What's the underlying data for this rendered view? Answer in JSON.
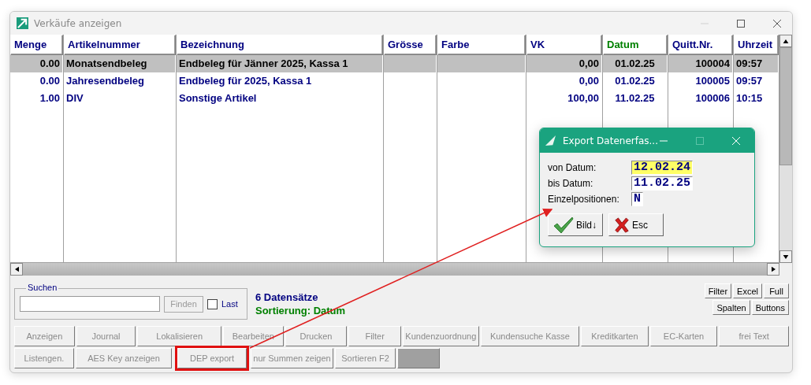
{
  "window": {
    "title": "Verkäufe anzeigen"
  },
  "table": {
    "columns": [
      {
        "label": "Menge",
        "sorted": false
      },
      {
        "label": "Artikelnummer",
        "sorted": false
      },
      {
        "label": "Bezeichnung",
        "sorted": false
      },
      {
        "label": "Grösse",
        "sorted": false
      },
      {
        "label": "Farbe",
        "sorted": false
      },
      {
        "label": "VK",
        "sorted": false
      },
      {
        "label": "Datum",
        "sorted": true
      },
      {
        "label": "Quitt.Nr.",
        "sorted": false
      },
      {
        "label": "Uhrzeit",
        "sorted": false
      }
    ],
    "rows": [
      {
        "selected": true,
        "cells": [
          "0.00",
          "Monatsendbeleg",
          "Endbeleg für Jänner 2025, Kassa 1",
          null,
          null,
          "0,00",
          "01.02.25",
          "100004",
          "09:57"
        ]
      },
      {
        "selected": false,
        "cells": [
          "0.00",
          "Jahresendbeleg",
          "Endbeleg für 2025, Kassa 1",
          null,
          null,
          "0,00",
          "01.02.25",
          "100005",
          "09:57"
        ]
      },
      {
        "selected": false,
        "cells": [
          "1.00",
          "DIV",
          "Sonstige Artikel",
          null,
          null,
          "100,00",
          "11.02.25",
          "100006",
          "10:15"
        ]
      }
    ]
  },
  "search": {
    "label": "Suchen",
    "button": {
      "label": "Finden",
      "disabled": true
    },
    "last": {
      "label": "Last",
      "checked": false
    }
  },
  "status": {
    "count": "6 Datensätze",
    "sorting": "Sortierung: Datum"
  },
  "view_buttons": [
    [
      "Filter",
      "Excel",
      "Full"
    ],
    [
      "Spalten",
      "Buttons"
    ]
  ],
  "action_rows": [
    [
      {
        "kind": "button",
        "label": "Anzeigen",
        "disabled": true
      },
      {
        "kind": "button",
        "label": "Journal",
        "disabled": true
      },
      {
        "kind": "button",
        "label": "Lokalisieren",
        "disabled": true
      },
      {
        "kind": "button",
        "label": "Bearbeiten",
        "disabled": true
      },
      {
        "kind": "button",
        "label": "Drucken",
        "disabled": true
      },
      {
        "kind": "button",
        "label": "Filter",
        "disabled": true
      },
      {
        "kind": "button",
        "label": "Kundenzuordnung",
        "disabled": true
      },
      {
        "kind": "button",
        "label": "Kundensuche Kasse",
        "disabled": true
      },
      {
        "kind": "button",
        "label": "Kreditkarten",
        "disabled": true
      },
      {
        "kind": "button",
        "label": "EC-Karten",
        "disabled": true
      },
      {
        "kind": "button",
        "label": "frei Text",
        "disabled": true
      }
    ],
    [
      {
        "kind": "button",
        "label": "Listengen.",
        "disabled": true
      },
      {
        "kind": "button",
        "label": "AES Key anzeigen",
        "disabled": true
      },
      {
        "kind": "button",
        "label": "DEP export",
        "disabled": true,
        "highlighted": true
      },
      {
        "kind": "button",
        "label": "nur Summen zeigen",
        "disabled": true
      },
      {
        "kind": "button",
        "label": "Sortieren F2",
        "disabled": true
      },
      {
        "kind": "blank"
      }
    ]
  ],
  "dialog": {
    "title": "Export Datenerfas...",
    "fields": [
      {
        "label": "von Datum:",
        "value": "12.02.24",
        "focused": true
      },
      {
        "label": "bis Datum:",
        "value": "11.02.25",
        "focused": false
      },
      {
        "label": "Einzelpositionen:",
        "value": "N",
        "focused": false
      }
    ],
    "buttons": [
      {
        "kind": "ok",
        "label": "Bild↓"
      },
      {
        "kind": "cancel",
        "label": "Esc"
      }
    ]
  }
}
